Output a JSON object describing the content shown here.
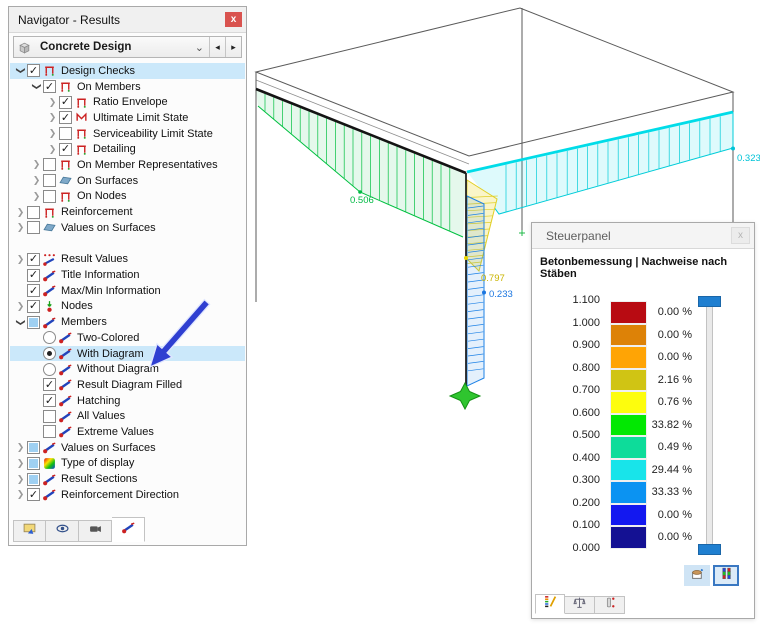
{
  "navigator": {
    "title": "Navigator - Results",
    "close_glyph": "x",
    "selector": {
      "label": "Concrete Design",
      "icon": "cube",
      "chevron": "⌄",
      "prev_arrow": "◂",
      "next_arrow": "▸"
    },
    "tree": [
      {
        "label": "Design Checks",
        "icon": "member-check",
        "control": "check",
        "state": "checked",
        "expander": "expanded",
        "indent": 0,
        "selected": true
      },
      {
        "label": "On Members",
        "icon": "member-check",
        "control": "check",
        "state": "checked",
        "expander": "expanded",
        "indent": 1
      },
      {
        "label": "Ratio Envelope",
        "icon": "member-check",
        "control": "check",
        "state": "checked",
        "expander": "collapsed",
        "indent": 2
      },
      {
        "label": "Ultimate Limit State",
        "icon": "member-check-m",
        "control": "check",
        "state": "checked",
        "expander": "collapsed",
        "indent": 2
      },
      {
        "label": "Serviceability Limit State",
        "icon": "member-check",
        "control": "check",
        "state": "unchecked",
        "expander": "collapsed",
        "indent": 2
      },
      {
        "label": "Detailing",
        "icon": "member-check",
        "control": "check",
        "state": "checked",
        "expander": "collapsed",
        "indent": 2
      },
      {
        "label": "On Member Representatives",
        "icon": "member-check",
        "control": "check",
        "state": "unchecked",
        "expander": "collapsed",
        "indent": 1
      },
      {
        "label": "On Surfaces",
        "icon": "surface",
        "control": "check",
        "state": "unchecked",
        "expander": "collapsed",
        "indent": 1
      },
      {
        "label": "On Nodes",
        "icon": "member-check",
        "control": "check",
        "state": "unchecked",
        "expander": "collapsed",
        "indent": 1
      },
      {
        "label": "Reinforcement",
        "icon": "member-check",
        "control": "check",
        "state": "unchecked",
        "expander": "collapsed",
        "indent": 0
      },
      {
        "label": "Values on Surfaces",
        "icon": "surface",
        "control": "check",
        "state": "unchecked",
        "expander": "collapsed",
        "indent": 0
      },
      {
        "gap": true
      },
      {
        "label": "Result Values",
        "icon": "result-values",
        "control": "check",
        "state": "checked",
        "expander": "collapsed",
        "indent": 0
      },
      {
        "label": "Title Information",
        "icon": "diagram",
        "control": "check",
        "state": "checked",
        "expander": "none",
        "indent": 0
      },
      {
        "label": "Max/Min Information",
        "icon": "diagram",
        "control": "check",
        "state": "checked",
        "expander": "none",
        "indent": 0
      },
      {
        "label": "Nodes",
        "icon": "nodes",
        "control": "check",
        "state": "checked",
        "expander": "collapsed",
        "indent": 0
      },
      {
        "label": "Members",
        "icon": "diagram",
        "control": "check",
        "state": "partial",
        "expander": "expanded",
        "indent": 0
      },
      {
        "label": "Two-Colored",
        "icon": "diagram",
        "control": "radio",
        "state": "off",
        "expander": "none",
        "indent": 1
      },
      {
        "label": "With Diagram",
        "icon": "diagram",
        "control": "radio",
        "state": "on",
        "expander": "none",
        "indent": 1,
        "selected": true
      },
      {
        "label": "Without Diagram",
        "icon": "diagram",
        "control": "radio",
        "state": "off",
        "expander": "none",
        "indent": 1
      },
      {
        "label": "Result Diagram Filled",
        "icon": "diagram",
        "control": "check",
        "state": "checked",
        "expander": "none",
        "indent": 1
      },
      {
        "label": "Hatching",
        "icon": "diagram",
        "control": "check",
        "state": "checked",
        "expander": "none",
        "indent": 1
      },
      {
        "label": "All Values",
        "icon": "diagram",
        "control": "check",
        "state": "unchecked",
        "expander": "none",
        "indent": 1
      },
      {
        "label": "Extreme Values",
        "icon": "diagram",
        "control": "check",
        "state": "unchecked",
        "expander": "none",
        "indent": 1
      },
      {
        "label": "Values on Surfaces",
        "icon": "diagram",
        "control": "check",
        "state": "partial",
        "expander": "collapsed",
        "indent": 0
      },
      {
        "label": "Type of display",
        "icon": "rainbow",
        "control": "check",
        "state": "partial",
        "expander": "collapsed",
        "indent": 0
      },
      {
        "label": "Result Sections",
        "icon": "diagram",
        "control": "check",
        "state": "partial",
        "expander": "collapsed",
        "indent": 0
      },
      {
        "label": "Reinforcement Direction",
        "icon": "diagram",
        "control": "check",
        "state": "checked",
        "expander": "collapsed",
        "indent": 0
      }
    ],
    "tabs": [
      {
        "icon": "display-tab",
        "name": "display-properties-tab",
        "selected": false
      },
      {
        "icon": "eye",
        "name": "views-tab",
        "selected": false
      },
      {
        "icon": "camera",
        "name": "visibility-tab",
        "selected": false
      },
      {
        "icon": "diagram",
        "name": "results-tab",
        "selected": true
      }
    ]
  },
  "viewport": {
    "result_labels": [
      {
        "text": "0.506",
        "color": "#00b944"
      },
      {
        "text": "0.797",
        "color": "#c9b400"
      },
      {
        "text": "0.233",
        "color": "#1b76e0"
      },
      {
        "text": "0.323",
        "color": "#00c3d7"
      }
    ],
    "support_icon": "fixed-support-star"
  },
  "panel": {
    "title": "Steuerpanel",
    "close_glyph": "x",
    "subtitle": "Betonbemessung | Nachweise nach Stäben",
    "scale": {
      "boundaries": [
        "1.100",
        "1.000",
        "0.900",
        "0.800",
        "0.700",
        "0.600",
        "0.500",
        "0.400",
        "0.300",
        "0.200",
        "0.100",
        "0.000"
      ],
      "bands": [
        {
          "color": "#b80b12",
          "percent": "0.00 %"
        },
        {
          "color": "#dd8207",
          "percent": "0.00 %"
        },
        {
          "color": "#ffa405",
          "percent": "0.00 %"
        },
        {
          "color": "#d0c414",
          "percent": "2.16 %"
        },
        {
          "color": "#fdfd0d",
          "percent": "0.76 %"
        },
        {
          "color": "#02e802",
          "percent": "33.82 %"
        },
        {
          "color": "#0ddc9a",
          "percent": "0.49 %"
        },
        {
          "color": "#18e4ea",
          "percent": "29.44 %"
        },
        {
          "color": "#0b93f2",
          "percent": "33.33 %"
        },
        {
          "color": "#1318f0",
          "percent": "0.00 %"
        },
        {
          "color": "#141193",
          "percent": "0.00 %"
        }
      ]
    },
    "buttons": [
      {
        "icon": "bucket",
        "name": "panel-options-button",
        "selected": false
      },
      {
        "icon": "colorbar-btn",
        "name": "color-scale-button",
        "selected": true
      }
    ],
    "tabs": [
      {
        "icon": "colorscale-tab",
        "name": "color-scale-tab",
        "selected": true
      },
      {
        "icon": "balance",
        "name": "factors-tab",
        "selected": false
      },
      {
        "icon": "pen-red",
        "name": "filter-tab",
        "selected": false
      }
    ]
  }
}
